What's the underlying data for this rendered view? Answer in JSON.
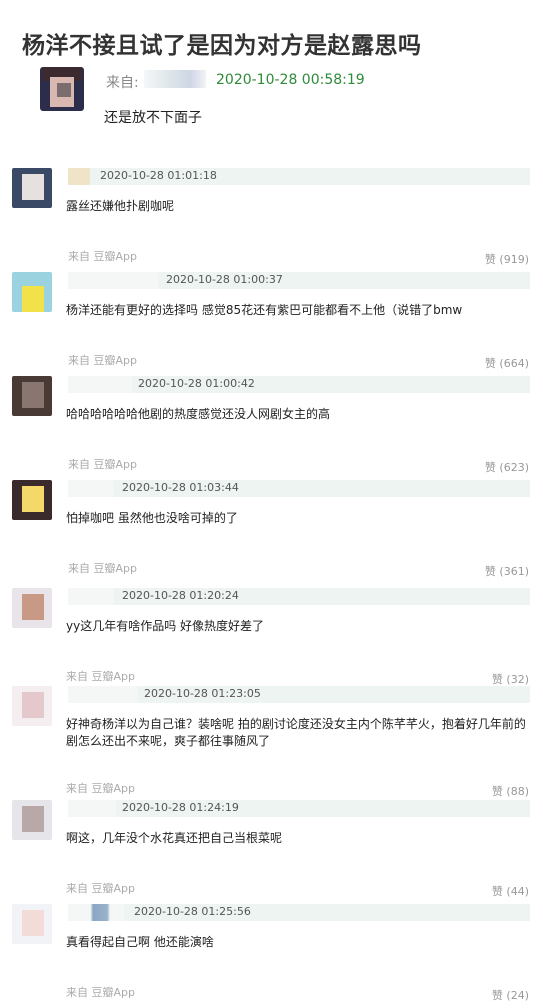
{
  "post": {
    "title": "杨洋不接且试了是因为对方是赵露思吗",
    "from_label": "来自:",
    "time": "2020-10-28 00:58:19",
    "text": "还是放不下面子"
  },
  "comments": [
    {
      "time": "2020-10-28 01:01:18",
      "text": "露丝还嫌他扑剧咖呢",
      "source": "来自 豆瓣App",
      "likes": "赞 (919)"
    },
    {
      "time": "2020-10-28 01:00:37",
      "text": "杨洋还能有更好的选择吗 感觉85花还有紫巴可能都看不上他（说错了bmw",
      "source": "来自 豆瓣App",
      "likes": "赞 (664)"
    },
    {
      "time": "2020-10-28 01:00:42",
      "text": "哈哈哈哈哈哈他剧的热度感觉还没人网剧女主的高",
      "source": "来自 豆瓣App",
      "likes": "赞 (623)"
    },
    {
      "time": "2020-10-28 01:03:44",
      "text": "怕掉咖吧 虽然他也没啥可掉的了",
      "source": "来自 豆瓣App",
      "likes": "赞 (361)"
    },
    {
      "time": "2020-10-28 01:20:24",
      "text": "yy这几年有啥作品吗 好像热度好差了",
      "source": "来自 豆瓣App",
      "likes": "赞 (32)"
    },
    {
      "time": "2020-10-28 01:23:05",
      "text": "好神奇杨洋以为自己谁？装啥呢 拍的剧讨论度还没女主内个陈芊芊火，抱着好几年前的剧怎么还出不来呢，爽子都往事随风了",
      "source": "来自 豆瓣App",
      "likes": "赞 (88)"
    },
    {
      "time": "2020-10-28 01:24:19",
      "text": "啊这，几年没个水花真还把自己当根菜呢",
      "source": "来自 豆瓣App",
      "likes": "赞 (44)"
    },
    {
      "time": "2020-10-28 01:25:56",
      "text": "真看得起自己啊 他还能演啥",
      "source": "来自 豆瓣App",
      "likes": "赞 (24)"
    }
  ]
}
